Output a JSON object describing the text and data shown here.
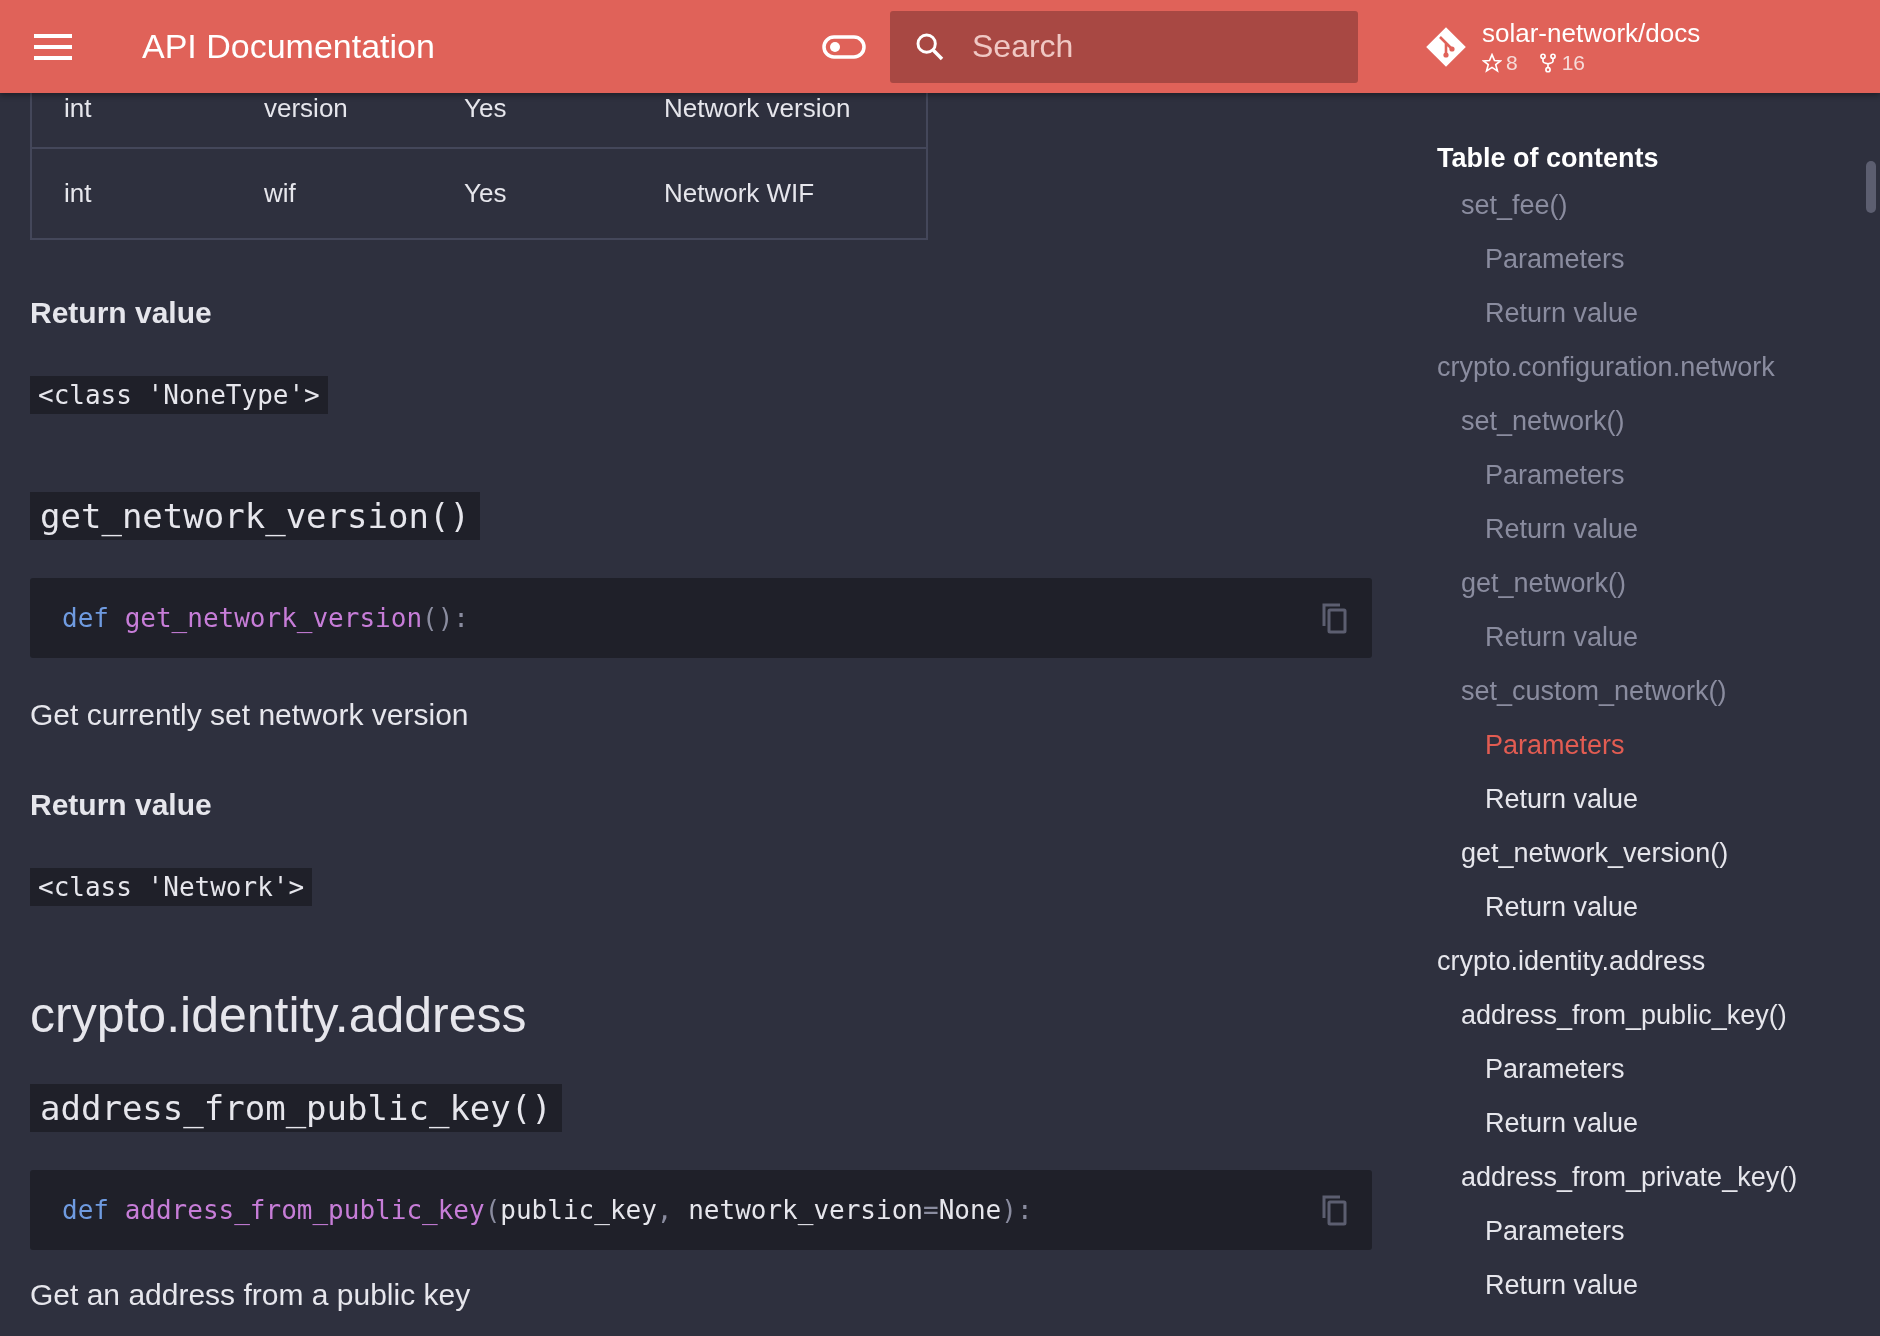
{
  "header": {
    "title": "API Documentation",
    "search": {
      "placeholder": "Search"
    },
    "repo": {
      "name": "solar-network/docs",
      "stars": "8",
      "forks": "16"
    }
  },
  "content": [
    {
      "kind": "table",
      "rows": [
        [
          "int",
          "version",
          "Yes",
          "Network version"
        ],
        [
          "int",
          "wif",
          "Yes",
          "Network WIF"
        ]
      ]
    },
    {
      "kind": "label",
      "text": "Return value"
    },
    {
      "kind": "inline_code",
      "text": "<class 'NoneType'>"
    },
    {
      "kind": "function",
      "text": "get_network_version()"
    },
    {
      "kind": "code",
      "tokens": [
        {
          "kind": "keyword",
          "text": "def"
        },
        {
          "kind": "name",
          "text": "get_network_version"
        },
        {
          "kind": "punct",
          "text": "():"
        }
      ]
    },
    {
      "kind": "paragraph",
      "text": "Get currently set network version"
    },
    {
      "kind": "label",
      "text": "Return value"
    },
    {
      "kind": "inline_code",
      "text": "<class 'Network'>"
    },
    {
      "kind": "section",
      "text": "crypto.identity.address"
    },
    {
      "kind": "function",
      "text": "address_from_public_key()"
    },
    {
      "kind": "code",
      "tokens": [
        {
          "kind": "keyword",
          "text": "def"
        },
        {
          "kind": "name",
          "text": "address_from_public_key"
        },
        {
          "kind": "punct",
          "text": "("
        },
        {
          "kind": "plain",
          "text": "public_key"
        },
        {
          "kind": "punct",
          "text": ", "
        },
        {
          "kind": "plain",
          "text": "network_version"
        },
        {
          "kind": "punct",
          "text": "="
        },
        {
          "kind": "plain",
          "text": "None"
        },
        {
          "kind": "punct",
          "text": "):"
        }
      ]
    },
    {
      "kind": "paragraph",
      "text": "Get an address from a public key"
    }
  ],
  "toc": {
    "title": "Table of contents",
    "items": [
      {
        "children": [
          {
            "label": "set_fee()",
            "visited": true,
            "selected": false,
            "children": [
              {
                "label": "Parameters",
                "visited": true,
                "selected": false
              },
              {
                "label": "Return value",
                "visited": true,
                "selected": false
              }
            ]
          }
        ]
      },
      {
        "label": "crypto.configuration.network",
        "visited": true,
        "selected": false,
        "children": [
          {
            "label": "set_network()",
            "visited": true,
            "selected": false,
            "children": [
              {
                "label": "Parameters",
                "visited": true,
                "selected": false
              },
              {
                "label": "Return value",
                "visited": true,
                "selected": false
              }
            ]
          },
          {
            "label": "get_network()",
            "visited": true,
            "selected": false,
            "children": [
              {
                "label": "Return value",
                "visited": true,
                "selected": false
              }
            ]
          },
          {
            "label": "set_custom_network()",
            "visited": true,
            "selected": false,
            "children": [
              {
                "label": "Parameters",
                "visited": false,
                "selected": true
              },
              {
                "label": "Return value",
                "visited": false,
                "selected": false
              }
            ]
          },
          {
            "label": "get_network_version()",
            "visited": false,
            "selected": false,
            "children": [
              {
                "label": "Return value",
                "visited": false,
                "selected": false
              }
            ]
          }
        ]
      },
      {
        "label": "crypto.identity.address",
        "visited": false,
        "selected": false,
        "children": [
          {
            "label": "address_from_public_key()",
            "visited": false,
            "selected": false,
            "children": [
              {
                "label": "Parameters",
                "visited": false,
                "selected": false
              },
              {
                "label": "Return value",
                "visited": false,
                "selected": false
              }
            ]
          },
          {
            "label": "address_from_private_key()",
            "visited": false,
            "selected": false,
            "children": [
              {
                "label": "Parameters",
                "visited": false,
                "selected": false
              },
              {
                "label": "Return value",
                "visited": false,
                "selected": false
              }
            ]
          }
        ]
      }
    ]
  }
}
